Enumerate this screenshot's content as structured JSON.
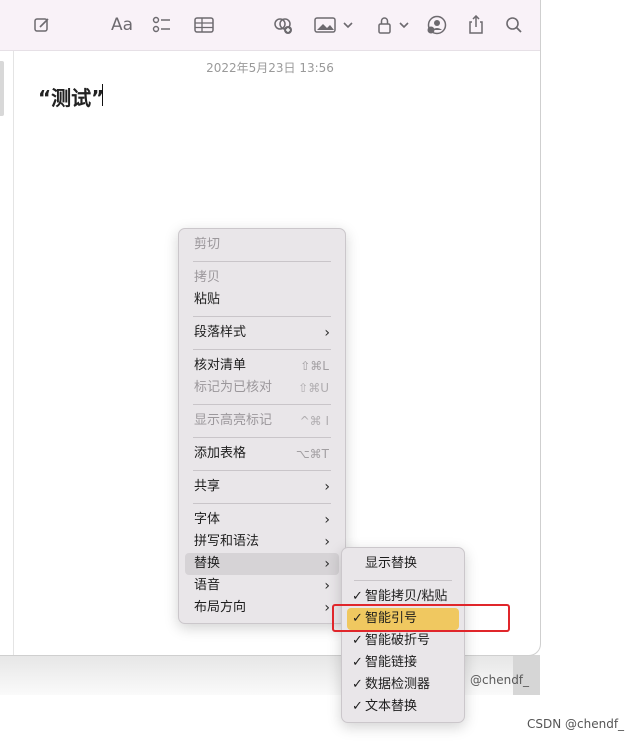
{
  "toolbar": {
    "icons": [
      "compose-icon",
      "text-format-icon",
      "checklist-icon",
      "table-icon",
      "collaborate-icon",
      "media-icon",
      "lock-icon",
      "account-icon",
      "share-icon",
      "search-icon"
    ],
    "format_label": "Aa"
  },
  "note": {
    "date": "2022年5月23日 13:56",
    "title": "“测试”"
  },
  "context_menu": {
    "cut": "剪切",
    "copy": "拷贝",
    "paste": "粘贴",
    "paragraph_style": "段落样式",
    "checklist": "核对清单",
    "checklist_shortcut": "⇧⌘L",
    "mark_checked": "标记为已核对",
    "mark_checked_shortcut": "⇧⌘U",
    "show_highlights": "显示高亮标记",
    "show_highlights_shortcut": "^⌘ I",
    "add_table": "添加表格",
    "add_table_shortcut": "⌥⌘T",
    "share": "共享",
    "font": "字体",
    "spelling": "拼写和语法",
    "substitutions": "替换",
    "speech": "语音",
    "layout_direction": "布局方向",
    "arrow": "›"
  },
  "submenu": {
    "show_substitutions": "显示替换",
    "check": "✓",
    "smart_copy_paste": "智能拷贝/粘贴",
    "smart_quotes": "智能引号",
    "smart_dashes": "智能破折号",
    "smart_links": "智能链接",
    "data_detectors": "数据检测器",
    "text_replacement": "文本替换"
  },
  "watermarks": {
    "inner": "@chendf_",
    "outer": "CSDN @chendf_"
  },
  "colors": {
    "toolbar_bg": "#f9f2f8",
    "menu_bg": "#e9e6e9",
    "highlight": "#f0c860",
    "annotation": "#e0262b"
  }
}
